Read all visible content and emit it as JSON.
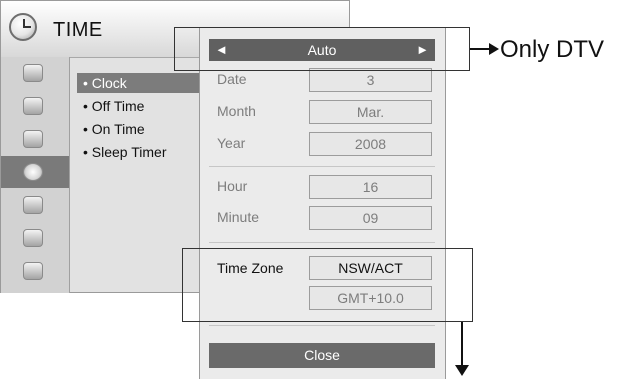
{
  "menu": {
    "title": "TIME",
    "items": [
      {
        "label": "• Clock",
        "active": true
      },
      {
        "label": "• Off Time",
        "active": false
      },
      {
        "label": "• On Time",
        "active": false
      },
      {
        "label": "• Sleep Timer",
        "active": false
      }
    ],
    "sidebar_icons": [
      "picture-icon",
      "screen-icon",
      "audio-icon",
      "time-icon",
      "lock-icon",
      "input-icon",
      "support-icon"
    ],
    "active_sidebar_index": 3
  },
  "dialog": {
    "mode_selector": {
      "value": "Auto",
      "left_arrow": "◄",
      "right_arrow": "►"
    },
    "date": {
      "label": "Date",
      "value": "3"
    },
    "month": {
      "label": "Month",
      "value": "Mar."
    },
    "year": {
      "label": "Year",
      "value": "2008"
    },
    "hour": {
      "label": "Hour",
      "value": "16"
    },
    "minute": {
      "label": "Minute",
      "value": "09"
    },
    "time_zone": {
      "label": "Time Zone",
      "value": "NSW/ACT",
      "offset": "GMT+10.0"
    },
    "close_label": "Close"
  },
  "annotations": {
    "dtv_note": "Only DTV"
  }
}
